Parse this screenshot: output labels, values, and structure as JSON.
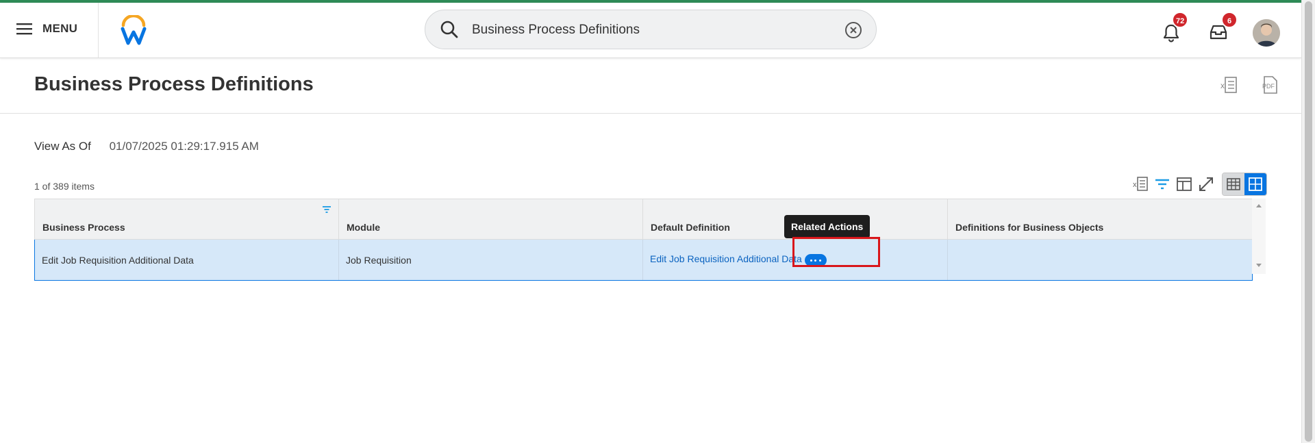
{
  "colors": {
    "accent": "#0875e1",
    "brand_top_bar": "#2e8b57",
    "badge": "#d0262c",
    "selection": "#d6e8f9",
    "highlight": "#d9161b"
  },
  "header": {
    "menu_label": "MENU",
    "menu_icon": "hamburger-icon",
    "logo": "workday-logo",
    "search": {
      "value": "Business Process Definitions",
      "icon": "search-icon",
      "clear_icon": "clear-icon"
    },
    "notifications": {
      "icon": "bell-icon",
      "count": "72"
    },
    "inbox": {
      "icon": "inbox-icon",
      "count": "6"
    },
    "avatar": "user-avatar"
  },
  "page": {
    "title": "Business Process Definitions",
    "export_icons": [
      "export-excel-icon",
      "export-pdf-icon"
    ]
  },
  "view_as_of": {
    "label": "View As Of",
    "value": "01/07/2025 01:29:17.915 AM"
  },
  "table": {
    "item_count": "1 of 389 items",
    "tools": [
      "export-excel-icon",
      "filter-icon",
      "column-layout-icon",
      "fullscreen-icon",
      "table-view-icon",
      "grid-view-icon"
    ],
    "columns": [
      "Business Process",
      "Module",
      "Default Definition",
      "Definitions for Business Objects"
    ],
    "rows": [
      {
        "business_process": "Edit Job Requisition Additional Data",
        "module": "Job Requisition",
        "default_definition": "Edit Job Requisition Additional Data",
        "definitions_for_business_objects": ""
      }
    ]
  },
  "tooltip": {
    "text": "Related Actions"
  }
}
